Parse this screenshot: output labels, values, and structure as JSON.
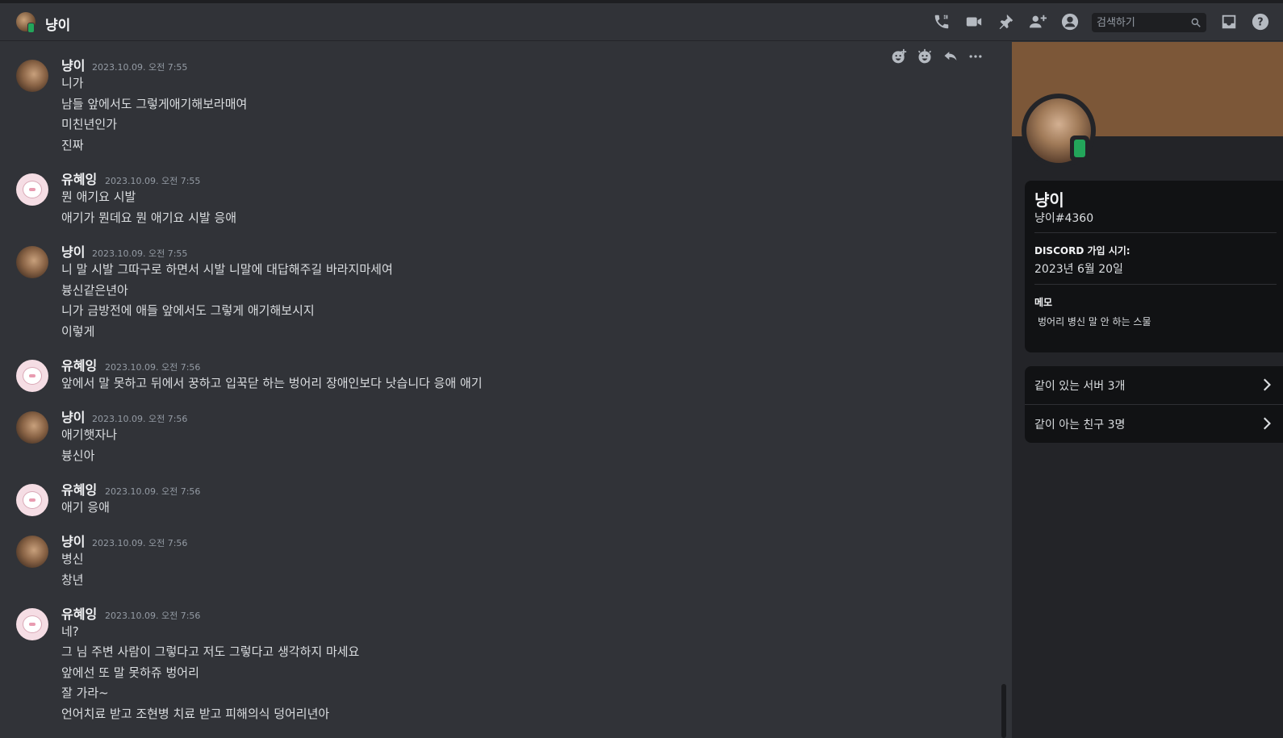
{
  "header": {
    "channel_name": "냥이",
    "search_placeholder": "검색하기"
  },
  "messages": [
    {
      "author": "냥이",
      "timestamp": "2023.10.09. 오전 7:55",
      "lines": [
        "니가",
        "남들 앞에서도 그렇게애기해보라매여",
        "미친년인가",
        "진짜"
      ]
    },
    {
      "author": "유혜잉",
      "timestamp": "2023.10.09. 오전 7:55",
      "lines": [
        "뭔 애기요 시발",
        "애기가 뭔데요 뭔 애기요 시발 응애"
      ]
    },
    {
      "author": "냥이",
      "timestamp": "2023.10.09. 오전 7:55",
      "lines": [
        "니 말 시발 그따구로 하면서 시발 니말에 대답해주길 바라지마세여",
        "븅신같은년아",
        "니가 금방전에 애들 앞에서도 그렇게 애기해보시지",
        "이렇게"
      ]
    },
    {
      "author": "유혜잉",
      "timestamp": "2023.10.09. 오전 7:56",
      "lines": [
        "앞에서 말 못하고 뒤에서 꿍하고 입꾹닫 하는 벙어리 장애인보다 낫습니다 응애 애기"
      ]
    },
    {
      "author": "냥이",
      "timestamp": "2023.10.09. 오전 7:56",
      "lines": [
        "애기햇자나",
        "븅신아"
      ]
    },
    {
      "author": "유혜잉",
      "timestamp": "2023.10.09. 오전 7:56",
      "lines": [
        "애기 응애"
      ]
    },
    {
      "author": "냥이",
      "timestamp": "2023.10.09. 오전 7:56",
      "lines": [
        "병신",
        "창년"
      ]
    },
    {
      "author": "유혜잉",
      "timestamp": "2023.10.09. 오전 7:56",
      "lines": [
        "네?",
        "그 님 주변 사람이 그렇다고 저도 그렇다고 생각하지 마세요",
        "앞에선 또 말 못하쥬 벙어리",
        "잘 가라~",
        "언어치료 받고 조현병 치료 받고 피해의식 덩어리년아"
      ]
    }
  ],
  "profile": {
    "display_name": "냥이",
    "username": "냥이#4360",
    "joined_label": "DISCORD 가입 시기:",
    "joined_value": "2023년 6월 20일",
    "memo_label": "메모",
    "memo_value": "벙어리 병신 말 안 하는 스물",
    "mutual_servers": "같이 있는 서버 3개",
    "mutual_friends": "같이 아는 친구 3명"
  },
  "icons": [
    "voice-call-icon",
    "video-call-icon",
    "pinned-messages-icon",
    "add-friends-icon",
    "user-profile-icon",
    "search-icon",
    "inbox-icon",
    "help-icon",
    "add-reaction-icon",
    "super-reaction-icon",
    "reply-icon",
    "more-icon",
    "mobile-status-icon",
    "chevron-right-icon"
  ],
  "colors": {
    "background": "#313338",
    "panel": "#232428",
    "card": "#111214",
    "banner": "#7c5738",
    "online": "#23a55a"
  }
}
